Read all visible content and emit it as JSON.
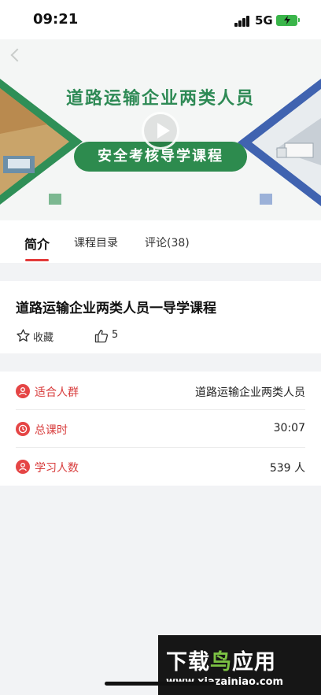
{
  "status_bar": {
    "time": "09:21",
    "network": "5G",
    "battery_state": "charging",
    "battery_color": "#3ab54a"
  },
  "video": {
    "banner_title": "道路运输企业两类人员",
    "banner_subtitle": "安全考核导学课程",
    "back_icon": "chevron-left-icon",
    "play_icon": "play-icon"
  },
  "tabs": [
    {
      "label": "简介",
      "active": true
    },
    {
      "label": "课程目录",
      "active": false
    },
    {
      "label": "评论(38)",
      "active": false
    }
  ],
  "course": {
    "title": "道路运输企业两类人员一导学课程",
    "favorite_label": "收藏",
    "likes": "5"
  },
  "info": [
    {
      "icon": "person-icon",
      "label": "适合人群",
      "value": "道路运输企业两类人员"
    },
    {
      "icon": "clock-icon",
      "label": "总课时",
      "value": "30:07"
    },
    {
      "icon": "person-icon",
      "label": "学习人数",
      "value": "539 人"
    }
  ],
  "watermark": {
    "title_white": "下载",
    "title_green": "鸟",
    "title_white2": "应用",
    "url": "www.xiazainiao.com"
  },
  "colors": {
    "accent_red": "#e33a3a",
    "banner_green": "#2d8b4e",
    "banner_blue": "#4063b0"
  }
}
